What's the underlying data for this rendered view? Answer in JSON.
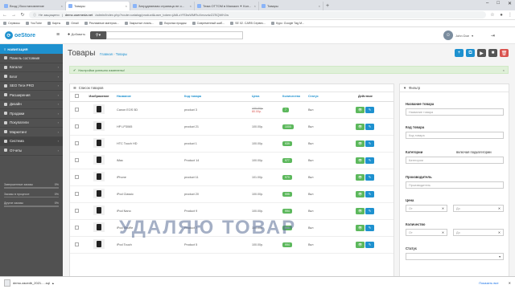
{
  "browser": {
    "tabs": [
      {
        "title": "Вход | Восстановление"
      },
      {
        "title": "Товары"
      },
      {
        "title": "Затрудняемая страница не о..."
      },
      {
        "title": "Тема OTTOM в Магазин ✦ Кол..."
      },
      {
        "title": "Товары"
      }
    ],
    "new_tab": "+",
    "address": {
      "security": "Не защищено",
      "host": "demo.userneda.net",
      "path": "/admin/index.php?route=catalog/product&user_token=jA6LzYR3wWMRuXmovdzZZSQWHJw"
    },
    "bookmarks": [
      "Сервисы",
      "YouTube",
      "Карты",
      "Gmail",
      "Рекламные материа...",
      "Закрытые лояль...",
      "Воронка продаж",
      "Современный шаб...",
      "SE 02. CARB Сервес...",
      "Курс: Google Tag M..."
    ]
  },
  "header": {
    "logo": "opencart",
    "logo_text": "oeStore",
    "add_label": "Добавить",
    "search_placeholder": "",
    "user_name": "John Doe"
  },
  "sidebar": {
    "nav_title": "НАВИГАЦИЯ",
    "items": [
      {
        "label": "Панель состояния",
        "chevron": false
      },
      {
        "label": "Каталог",
        "chevron": true
      },
      {
        "label": "Блог",
        "chevron": true
      },
      {
        "label": "SEO Теги PRO",
        "chevron": true
      },
      {
        "label": "Расширения",
        "chevron": true
      },
      {
        "label": "Дизайн",
        "chevron": true
      },
      {
        "label": "Продажи",
        "chevron": true
      },
      {
        "label": "Покупатели",
        "chevron": true
      },
      {
        "label": "Маркетинг",
        "chevron": true
      },
      {
        "label": "Система",
        "chevron": true
      },
      {
        "label": "Отчеты",
        "chevron": true
      }
    ],
    "stats": [
      {
        "label": "Завершенные заказы",
        "value": "0%",
        "fill": 0
      },
      {
        "label": "Заказы в процессе",
        "value": "0%",
        "fill": 0
      },
      {
        "label": "Другие заказы",
        "value": "0%",
        "fill": 0
      }
    ]
  },
  "page": {
    "title": "Товары",
    "breadcrumb": [
      "Главная",
      "Товары"
    ],
    "alert": "Настройки успешно изменены!",
    "alert_close": "×",
    "list_title": "Список товаров"
  },
  "table": {
    "headers": [
      "Изображение",
      "Название",
      "Код товара",
      "Цена",
      "Количество",
      "Статус",
      "Индекс",
      "Действие"
    ],
    "rows": [
      {
        "name": "Canon EOS 5D",
        "code": "product 3",
        "price_old": "100.00р.",
        "price_new": "80.00р.",
        "qty": "7",
        "qty_color": "#5cb85c",
        "status": "Вкл",
        "index": "Вкл"
      },
      {
        "name": "HP LP3065",
        "code": "product 21",
        "price_old": "",
        "price_new": "100.00р.",
        "qty": "1000",
        "qty_color": "#5cb85c",
        "status": "Вкл",
        "index": "Вкл"
      },
      {
        "name": "HTC Touch HD",
        "code": "product 1",
        "price_old": "",
        "price_new": "100.00р.",
        "qty": "939",
        "qty_color": "#5cb85c",
        "status": "Вкл",
        "index": "Вкл"
      },
      {
        "name": "iMac",
        "code": "Product 14",
        "price_old": "",
        "price_new": "100.00р.",
        "qty": "977",
        "qty_color": "#5cb85c",
        "status": "Вкл",
        "index": "Вкл"
      },
      {
        "name": "iPhone",
        "code": "product 11",
        "price_old": "",
        "price_new": "101.00р.",
        "qty": "970",
        "qty_color": "#5cb85c",
        "status": "Вкл",
        "index": "Вкл"
      },
      {
        "name": "iPod Classic",
        "code": "product 20",
        "price_old": "",
        "price_new": "100.00р.",
        "qty": "995",
        "qty_color": "#5cb85c",
        "status": "Вкл",
        "index": "Вкл"
      },
      {
        "name": "iPod Nano",
        "code": "Product 9",
        "price_old": "",
        "price_new": "100.00р.",
        "qty": "994",
        "qty_color": "#5cb85c",
        "status": "Вкл",
        "index": "Вкл"
      },
      {
        "name": "iPod Shuffle",
        "code": "Product 7",
        "price_old": "",
        "price_new": "100.00р.",
        "qty": "995",
        "qty_color": "#5cb85c",
        "status": "Вкл",
        "index": "Вкл"
      },
      {
        "name": "iPod Touch",
        "code": "Product 5",
        "price_old": "",
        "price_new": "100.00р.",
        "qty": "994",
        "qty_color": "#5cb85c",
        "status": "Вкл",
        "index": "Вкл"
      }
    ]
  },
  "filter": {
    "title": "Фильтр",
    "name_label": "Название товара",
    "name_placeholder": "Название товара",
    "code_label": "Код товара",
    "code_placeholder": "Код товара",
    "cat_label": "Категории",
    "subcat_label": "включая подкатегории",
    "cat_placeholder": "Категории",
    "maker_label": "Производитель",
    "maker_placeholder": "Производитель",
    "price_label": "Цена",
    "from": "От",
    "to": "До",
    "qty_label": "Количество",
    "status_label": "Статус"
  },
  "overlay_text": "УДАЛЯЮ ТОВАР",
  "download": {
    "file": "demo.zacedb_2021.....sql",
    "show_all": "Показать все"
  },
  "colors": {
    "primary": "#1e91cf",
    "success": "#5cb85c",
    "danger": "#d9534f",
    "sidebar": "#515151"
  }
}
